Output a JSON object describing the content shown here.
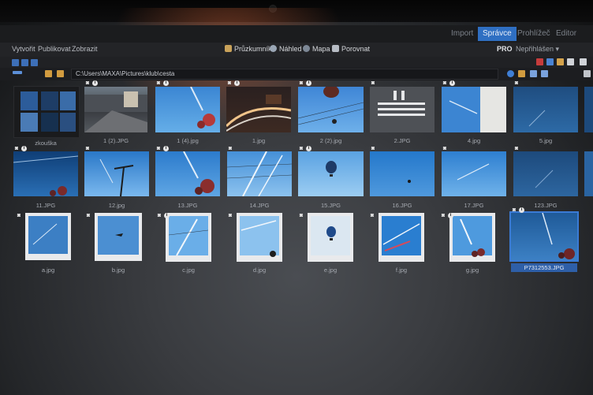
{
  "mode_tabs": [
    {
      "label": "Import",
      "active": false
    },
    {
      "label": "Správce",
      "active": true
    },
    {
      "label": "Prohlížeč",
      "active": false
    },
    {
      "label": "Editor",
      "active": false
    }
  ],
  "menu": [
    "Vytvořit",
    "Publikovat",
    "Zobrazit"
  ],
  "views": [
    {
      "label": "Průzkumník",
      "icon": "explorer-icon"
    },
    {
      "label": "Náhled",
      "icon": "preview-icon"
    },
    {
      "label": "Mapa",
      "icon": "map-icon"
    },
    {
      "label": "Porovnat",
      "icon": "compare-icon"
    }
  ],
  "right_menu": {
    "pro": "PRO",
    "account": "Nepřihlášen ▾"
  },
  "path": "C:\\Users\\MAXA\\Pictures\\klub\\cesta",
  "accent": "#2f6fc2",
  "folder": {
    "label": "zkouška"
  },
  "row1": [
    "1 (2).JPG",
    "1 (4).jpg",
    "1.jpg",
    "2 (2).jpg",
    "2.JPG",
    "4.jpg",
    "5.jpg"
  ],
  "row2": [
    "11.JPG",
    "12.jpg",
    "13.JPG",
    "14.JPG",
    "15.JPG",
    "16.JPG",
    "17.JPG",
    "123.JPG"
  ],
  "row3": [
    "a.jpg",
    "b.jpg",
    "c.jpg",
    "d.jpg",
    "e.jpg",
    "f.jpg",
    "g.jpg",
    "P7312553.JPG"
  ]
}
